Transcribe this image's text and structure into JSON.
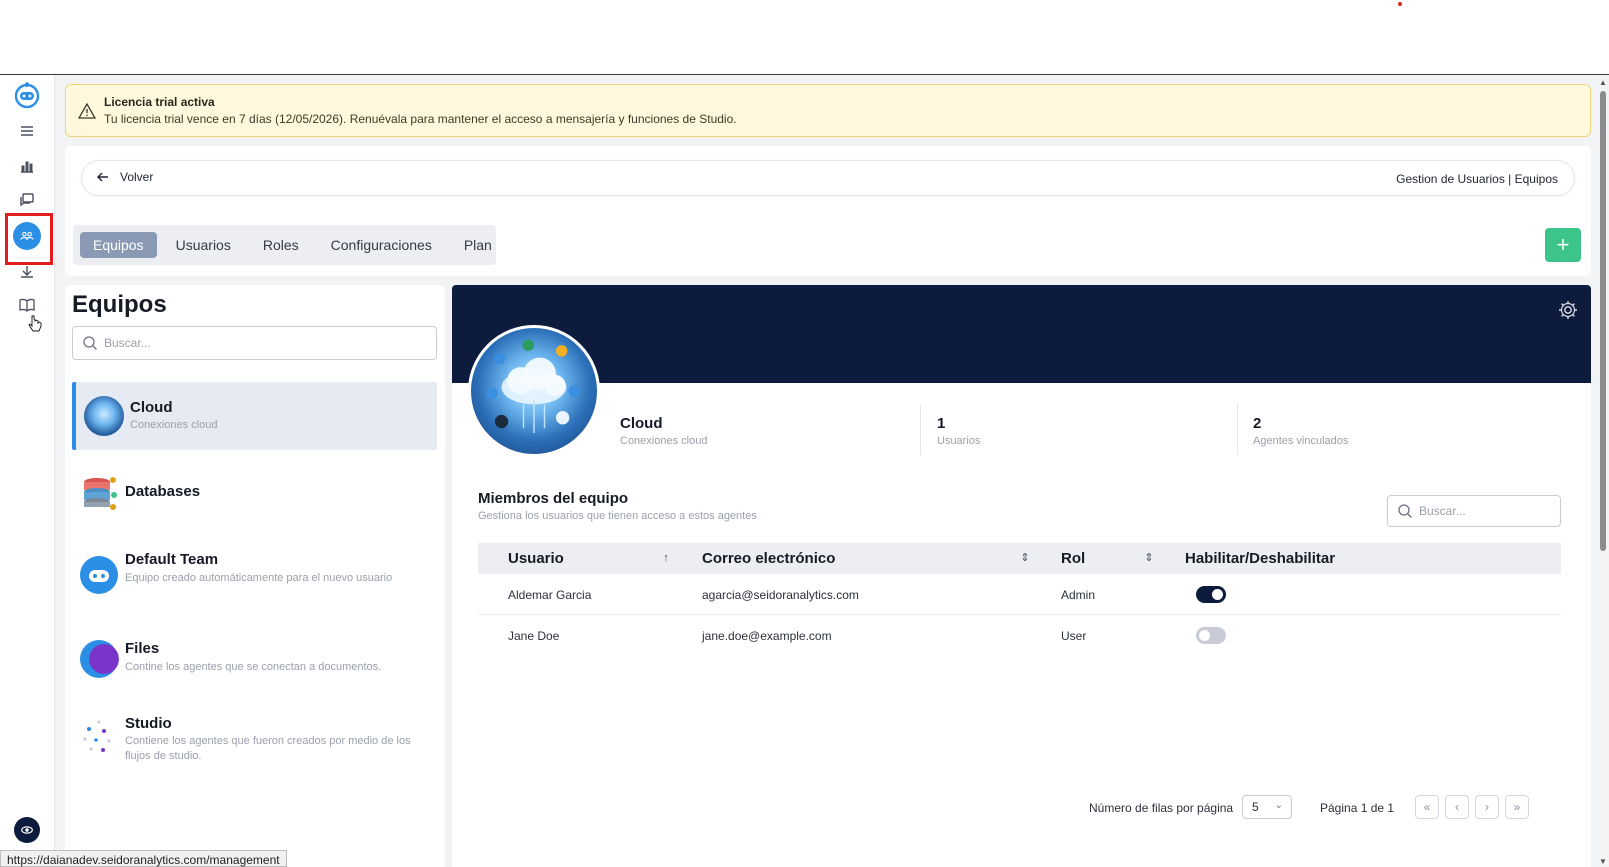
{
  "banner": {
    "title": "Licencia trial activa",
    "text": "Tu licencia trial vence en 7 días (12/05/2026). Renuévala para mantener el acceso a mensajería y funciones de Studio."
  },
  "header": {
    "back_label": "Volver",
    "breadcrumb": "Gestion de Usuarios | Equipos",
    "tabs": [
      {
        "label": "Equipos",
        "active": true
      },
      {
        "label": "Usuarios",
        "active": false
      },
      {
        "label": "Roles",
        "active": false
      },
      {
        "label": "Configuraciones",
        "active": false
      },
      {
        "label": "Plan",
        "active": false
      }
    ],
    "add_label": "+"
  },
  "teams": {
    "title": "Equipos",
    "search_placeholder": "Buscar...",
    "items": [
      {
        "name": "Cloud",
        "desc": "Conexiones cloud",
        "selected": true
      },
      {
        "name": "Databases",
        "desc": "",
        "selected": false
      },
      {
        "name": "Default Team",
        "desc": "Equipo creado automáticamente para el nuevo usuario",
        "selected": false
      },
      {
        "name": "Files",
        "desc": "Contine los agentes que se conectan a documentos.",
        "selected": false
      },
      {
        "name": "Studio",
        "desc": "Contiene los agentes que fueron creados por medio de los flujos de studio.",
        "selected": false
      }
    ]
  },
  "detail": {
    "name": "Cloud",
    "desc": "Conexiones cloud",
    "users_count": "1",
    "users_label": "Usuarios",
    "agents_count": "2",
    "agents_label": "Agentes vinculados",
    "members_title": "Miembros del equipo",
    "members_sub": "Gestiona los usuarios que tienen acceso a estos agentes",
    "search_placeholder": "Buscar...",
    "columns": [
      "Usuario",
      "Correo electrónico",
      "Rol",
      "Habilitar/Deshabilitar"
    ],
    "rows": [
      {
        "user": "Aldemar Garcia",
        "email": "agarcia@seidoranalytics.com",
        "role": "Admin",
        "enabled": true
      },
      {
        "user": "Jane Doe",
        "email": "jane.doe@example.com",
        "role": "User",
        "enabled": false
      }
    ],
    "rows_per_page_label": "Número de filas por página",
    "rows_per_page": "5",
    "page_label": "Página 1 de 1",
    "pager_buttons": [
      "«",
      "‹",
      "›",
      "»"
    ]
  },
  "status_url": "https://daianadev.seidoranalytics.com/management",
  "colors": {
    "accent": "#2b8fe6",
    "navy": "#0d1b3d",
    "add_green": "#3cc48a",
    "banner_bg": "#fff8dc"
  },
  "icons": [
    "bot-logo-icon",
    "menu-icon",
    "bar-chart-icon",
    "chat-icon",
    "team-icon",
    "download-icon",
    "book-icon",
    "warning-icon",
    "arrow-left-icon",
    "search-icon",
    "gear-icon",
    "sort-icon"
  ]
}
